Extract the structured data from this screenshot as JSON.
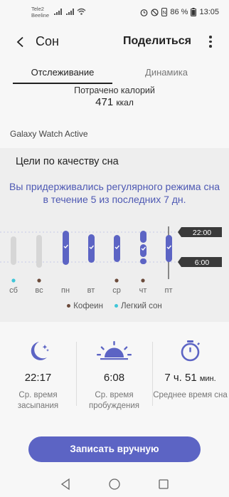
{
  "status_bar": {
    "carrier_1": "Tele2",
    "carrier_2": "Beeline",
    "battery": "86 %",
    "time": "13:05"
  },
  "app_bar": {
    "title": "Сон",
    "share_label": "Поделиться"
  },
  "tabs": [
    {
      "label": "Отслеживание",
      "active": true
    },
    {
      "label": "Динамика",
      "active": false
    }
  ],
  "calories": {
    "label": "Потрачено калорий",
    "value": "471",
    "unit": "ккал"
  },
  "device": "Galaxy Watch Active",
  "goals": {
    "title": "Цели по качеству сна",
    "message": "Вы придерживались регулярного режима сна в течение 5 из последних 7 дн."
  },
  "chart_data": {
    "type": "range-bar",
    "categories": [
      "сб",
      "вс",
      "пн",
      "вт",
      "ср",
      "чт",
      "пт"
    ],
    "goal_start": "22:00",
    "goal_end": "6:00",
    "series": [
      {
        "days": [
          "сб",
          "вс"
        ],
        "on_goal": [
          false,
          false
        ]
      },
      {
        "days": [
          "пн",
          "вт",
          "ср",
          "чт",
          "пт"
        ],
        "on_goal": [
          true,
          true,
          true,
          true,
          true
        ]
      }
    ],
    "markers": {
      "сб": "Легкий сон",
      "вс": "Кофеин",
      "ср": "Кофеин",
      "чт": "Кофеин"
    },
    "legend": [
      "Кофеин",
      "Легкий сон"
    ],
    "colors": {
      "goal_met": "#5c64c4",
      "no_data": "#d6d6d6",
      "caffeine": "#6b4a3a",
      "light_sleep": "#3fc6d8"
    }
  },
  "stats": [
    {
      "icon": "moon-icon",
      "value": "22:17",
      "label": "Ср. время засыпания"
    },
    {
      "icon": "sunrise-icon",
      "value": "6:08",
      "label": "Ср. время пробуждения"
    },
    {
      "icon": "stopwatch-icon",
      "value": "7 ч. 51",
      "unit": "мин.",
      "label": "Среднее время сна"
    }
  ],
  "record_button": "Записать вручную",
  "accent_color": "#5c64c4"
}
